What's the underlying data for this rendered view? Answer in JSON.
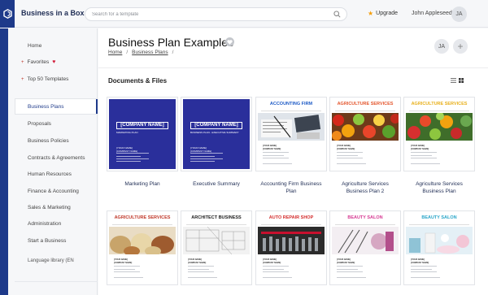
{
  "brand": {
    "name": "Business in a Box"
  },
  "search": {
    "placeholder": "Search for a template"
  },
  "user": {
    "upgrade": "Upgrade",
    "name": "John Appleseed",
    "initials": "JA"
  },
  "sidebar": {
    "home": "Home",
    "favorites": "Favorites",
    "top": "Top 50 Templates",
    "active": "Business Plans",
    "items": [
      "Proposals",
      "Business Policies",
      "Contracts & Agreements",
      "Human Resources",
      "Finance & Accounting",
      "Sales & Marketing",
      "Administration",
      "Start a Business"
    ],
    "language": "Language library (EN"
  },
  "main": {
    "title": "Business Plan Examples",
    "breadcrumb": [
      "Home",
      "Business Plans"
    ],
    "initials": "JA",
    "add": "+",
    "section": "Documents & Files"
  },
  "cards": [
    {
      "caption_lines": [
        "Marketing Plan"
      ],
      "cover": {
        "kind": "blue",
        "company": "[COMPANY NAME]",
        "plan": "MARKETING PLAN"
      }
    },
    {
      "caption_lines": [
        "Executive Summary"
      ],
      "cover": {
        "kind": "blue",
        "company": "[COMPANY NAME]",
        "plan": "BUSINESS PLAN - EXECUTIVE SUMMARY"
      }
    },
    {
      "caption_lines": [
        "Accounting Firm Business",
        "Plan"
      ],
      "cover": {
        "kind": "photo",
        "heading": "ACCOUNTING FIRM",
        "heading_color": "#1e5bc6",
        "scene": "accounting"
      }
    },
    {
      "caption_lines": [
        "Agriculture Services",
        "Business Plan 2"
      ],
      "cover": {
        "kind": "photo",
        "heading": "AGRICULTURE SERVICES",
        "heading_color": "#e4572e",
        "scene": "produce"
      }
    },
    {
      "caption_lines": [
        "Agriculture Services",
        "Business Plan"
      ],
      "cover": {
        "kind": "photo",
        "heading": "AGRICULTURE SERVICES",
        "heading_color": "#e8b01c",
        "scene": "vegetables"
      }
    },
    {
      "caption_lines": [],
      "cover": {
        "kind": "photo",
        "heading": "AGRICULTURE SERVICES",
        "heading_color": "#c0392b",
        "scene": "grain"
      }
    },
    {
      "caption_lines": [],
      "cover": {
        "kind": "photo",
        "heading": "ARCHITECT BUSINESS",
        "heading_color": "#222222",
        "scene": "blueprint"
      }
    },
    {
      "caption_lines": [],
      "cover": {
        "kind": "photo",
        "heading": "AUTO REPAIR SHOP",
        "heading_color": "#d42e2e",
        "scene": "tools"
      }
    },
    {
      "caption_lines": [],
      "cover": {
        "kind": "photo",
        "heading": "BEAUTY SALON",
        "heading_color": "#d63b93",
        "scene": "salon"
      }
    },
    {
      "caption_lines": [],
      "cover": {
        "kind": "photo",
        "heading": "BEAUTY SALON",
        "heading_color": "#2aa6c9",
        "scene": "spa"
      }
    }
  ],
  "cover_common": {
    "your_name": "[YOUR NAME]",
    "company_name": "[COMPANY NAME]"
  },
  "colors": {
    "accent": "#1e3a8a",
    "cover_blue": "#2a2f9b",
    "star": "#f59e0b"
  },
  "icons": [
    "logo-icon",
    "search-icon",
    "star-icon",
    "heart-icon",
    "list-view-icon",
    "grid-view-icon"
  ]
}
